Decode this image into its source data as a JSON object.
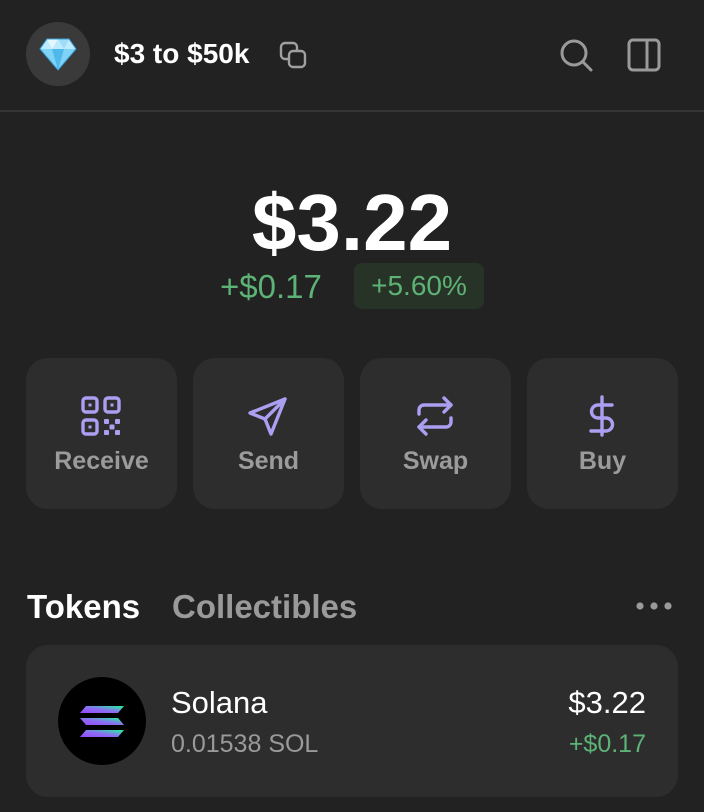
{
  "header": {
    "account_name": "$3 to $50k",
    "avatar_icon": "gem-icon"
  },
  "balance": {
    "total": "$3.22",
    "change_abs": "+$0.17",
    "change_pct": "+5.60%",
    "positive_color": "#5db275"
  },
  "actions": [
    {
      "label": "Receive",
      "icon": "qr-code-icon"
    },
    {
      "label": "Send",
      "icon": "send-icon"
    },
    {
      "label": "Swap",
      "icon": "swap-icon"
    },
    {
      "label": "Buy",
      "icon": "dollar-icon"
    }
  ],
  "accent_color": "#ab9ff2",
  "tabs": [
    {
      "label": "Tokens",
      "active": true
    },
    {
      "label": "Collectibles",
      "active": false
    }
  ],
  "tokens": [
    {
      "name": "Solana",
      "amount": "0.01538 SOL",
      "value": "$3.22",
      "change": "+$0.17",
      "icon": "solana-logo-icon"
    }
  ]
}
